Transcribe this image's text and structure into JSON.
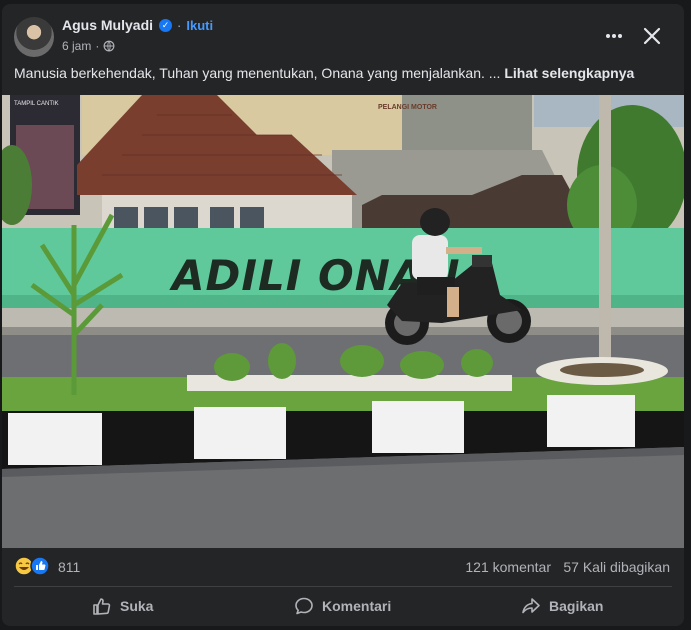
{
  "post": {
    "author": "Agus Mulyadi",
    "follow_label": "Ikuti",
    "time": "6 jam",
    "dot": "·",
    "caption": "Manusia berkehendak, Tuhan yang menentukan, Onana yang menjalankan. ...",
    "see_more": "Lihat selengkapnya"
  },
  "photo": {
    "graffiti": "ADILI ONANA",
    "shop_sign": "PELANGI MOTOR",
    "banner_text": "TAMPIL CANTIK"
  },
  "stats": {
    "reaction_count": "811",
    "comments": "121 komentar",
    "shares": "57 Kali dibagikan"
  },
  "actions": {
    "like": "Suka",
    "comment": "Komentari",
    "share": "Bagikan"
  },
  "icons": [
    "more-icon",
    "close-icon",
    "globe-icon",
    "verified-icon",
    "haha-icon",
    "like-icon",
    "comment-icon",
    "share-icon"
  ],
  "colors": {
    "background": "#18191a",
    "card": "#242526",
    "accent": "#1877f2",
    "link": "#4599ff"
  }
}
